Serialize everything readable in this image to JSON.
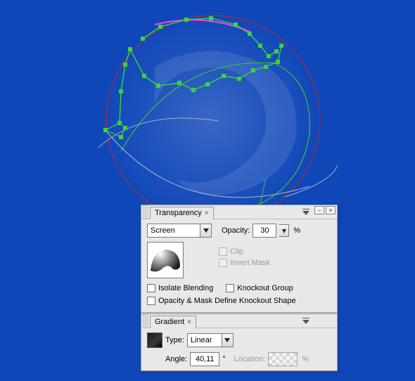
{
  "canvas": {
    "bg": "#0f46b8"
  },
  "transparency": {
    "tab_label": "Transparency",
    "blend_mode": "Screen",
    "opacity_label": "Opacity:",
    "opacity_value": "30",
    "pct": "%",
    "clip_label": "Clip",
    "invert_label": "Invert Mask",
    "isolate_label": "Isolate Blending",
    "knockout_label": "Knockout Group",
    "opacitymask_label": "Opacity & Mask Define Knockout Shape"
  },
  "gradient": {
    "tab_label": "Gradient",
    "type_label": "Type:",
    "type_value": "Linear",
    "angle_label": "Angle:",
    "angle_value": "40,11",
    "angle_unit": "°",
    "location_label": "Location:",
    "location_value": "",
    "pct": "%"
  }
}
